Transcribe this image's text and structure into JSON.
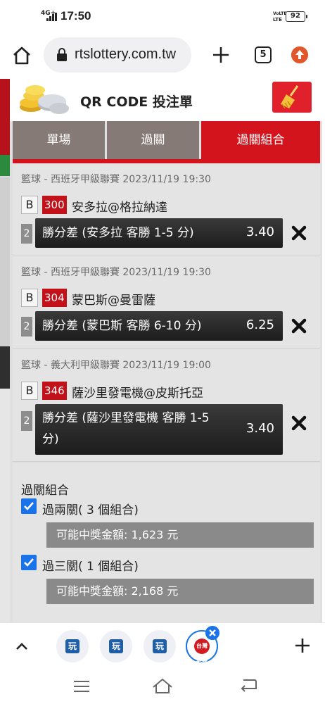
{
  "status_bar": {
    "network": "4G+",
    "time": "17:50",
    "volte_top": "VoLTE",
    "volte_bottom": "LTE",
    "battery": "92"
  },
  "browser": {
    "url": "rtslottery.com.tw",
    "tab_count": "5"
  },
  "modal": {
    "title": "QR CODE 投注單",
    "tabs": [
      {
        "label": "單場",
        "active": false
      },
      {
        "label": "過關",
        "active": false
      },
      {
        "label": "過關組合",
        "active": true
      }
    ],
    "bets": [
      {
        "meta": "籃球 - 西班牙甲級聯賽 2023/11/19 19:30",
        "letter": "B",
        "number": "300",
        "teams": "安多拉@格拉納達",
        "multiplier": "2",
        "selection": "勝分差 (安多拉 客勝 1-5 分)",
        "odds": "3.40"
      },
      {
        "meta": "籃球 - 西班牙甲級聯賽 2023/11/19 19:30",
        "letter": "B",
        "number": "304",
        "teams": "蒙巴斯@曼雷薩",
        "multiplier": "2",
        "selection": "勝分差 (蒙巴斯 客勝 6-10 分)",
        "odds": "6.25"
      },
      {
        "meta": "籃球 - 義大利甲級聯賽 2023/11/19 19:00",
        "letter": "B",
        "number": "346",
        "teams": "薩沙里發電機@皮斯托亞",
        "multiplier": "2",
        "selection_line1": "勝分差 (薩沙里發電機 客勝 1-5",
        "selection_line2": "分)",
        "odds": "3.40"
      }
    ],
    "combo": {
      "heading": "過關組合",
      "options": [
        {
          "label": "過兩關( 3 個組合)",
          "checked": true,
          "prize": "可能中獎金額: 1,623 元"
        },
        {
          "label": "過三關( 1 個組合)",
          "checked": true,
          "prize": "可能中獎金額: 2,168 元"
        }
      ]
    }
  },
  "bottom_tabs": {
    "icon_label": "玩",
    "selected_icon_label": "台灣彩券"
  },
  "colors": {
    "accent_red": "#d4141d",
    "tab_inactive": "#857a76",
    "checkbox_blue": "#1a73e8"
  }
}
